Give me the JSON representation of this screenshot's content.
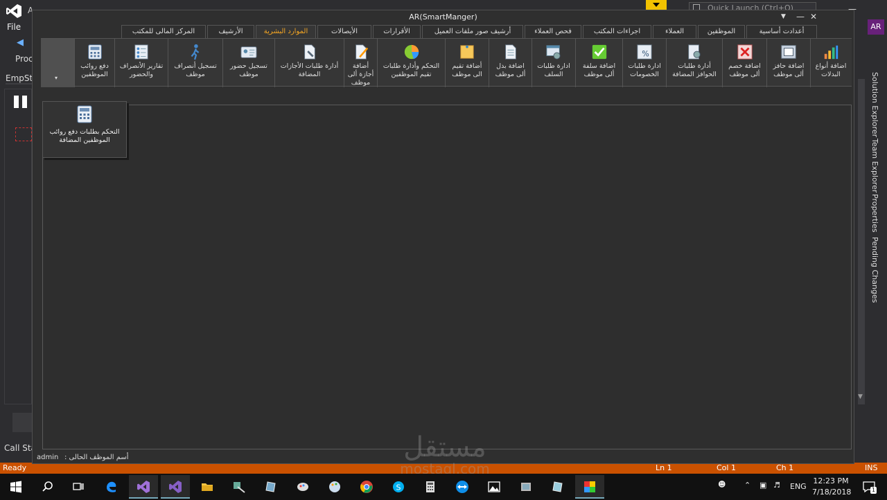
{
  "vs": {
    "title": "A",
    "menu_file": "File",
    "proc_label": "Proc",
    "empsta_label": "EmpSta",
    "callstack_label": "Call Stac",
    "quick_launch_placeholder": "Quick Launch (Ctrl+Q)",
    "avatar_initials": "AR",
    "side_tabs": [
      "Solution Explorer",
      "Team Explorer",
      "Properties",
      "Pending Changes"
    ],
    "status": {
      "ready": "Ready",
      "ln": "Ln 1",
      "col": "Col 1",
      "ch": "Ch 1",
      "ins": "INS"
    }
  },
  "form": {
    "title": "AR(SmartManger)",
    "tabs": [
      {
        "label": "أعدادت أساسية"
      },
      {
        "label": "الموظفين"
      },
      {
        "label": "العملاء"
      },
      {
        "label": "اجراءات المكتب"
      },
      {
        "label": "فحص العملاء"
      },
      {
        "label": "أرشيف صور ملفات العميل"
      },
      {
        "label": "الأقرارات"
      },
      {
        "label": "الأيصالات"
      },
      {
        "label": "الموارد البشرية",
        "active": true
      },
      {
        "label": "الأرشيف"
      },
      {
        "label": "المركز المالى للمكتب"
      }
    ],
    "ribbon": [
      {
        "label": "اضافة أنواع البدلات",
        "icon": "bar-chart-icon"
      },
      {
        "label": "اضافة حافز ألى موظف",
        "icon": "frame-icon"
      },
      {
        "label": "اضافة خصم ألى موظف",
        "icon": "x-mark-icon"
      },
      {
        "label": "أدارة طلبات الحوافز المضافة",
        "icon": "notebook-gear-icon"
      },
      {
        "label": "ادارة طلبات الخصومات",
        "icon": "percent-table-icon"
      },
      {
        "label": "اضافة سلفة ألى موظف",
        "icon": "checkmark-icon"
      },
      {
        "label": "ادارة طلبات السلف",
        "icon": "window-gear-icon"
      },
      {
        "label": "اضافة بدل ألى موظف",
        "icon": "document-icon"
      },
      {
        "label": "أضافة تقيم الى موظف",
        "icon": "sticky-note-icon"
      },
      {
        "label": "التحكم وأدارة طلبات تقيم الموظفين",
        "icon": "pie-chart-icon"
      },
      {
        "label": "أضافة أجازة ألى موظف",
        "icon": "edit-document-icon"
      },
      {
        "label": "أدارة طلبات الأجازات المضافة",
        "icon": "document-wrench-icon"
      },
      {
        "label": "تسجيل حضور موظف",
        "icon": "id-card-icon"
      },
      {
        "label": "تسجيل أنصراف موظف",
        "icon": "walking-person-icon"
      },
      {
        "label": "تقارير الأنصراف والحضور",
        "icon": "report-list-icon"
      },
      {
        "label": "دفع روائب الموظفين",
        "icon": "calculator-icon"
      }
    ],
    "dropdown_arrow": "▾",
    "popup": {
      "label": "التحكم بطلبات دفع روائب الموظفين المضافة",
      "icon": "calculator-icon"
    },
    "status": {
      "user": "admin",
      "label": "أسم الموظف الحالى :"
    }
  },
  "taskbar": {
    "time": "12:23 PM",
    "date": "7/18/2018",
    "lang": "ENG",
    "notif_count": "1"
  },
  "watermark": {
    "text": "مستقل",
    "sub": "mostaql.com"
  }
}
